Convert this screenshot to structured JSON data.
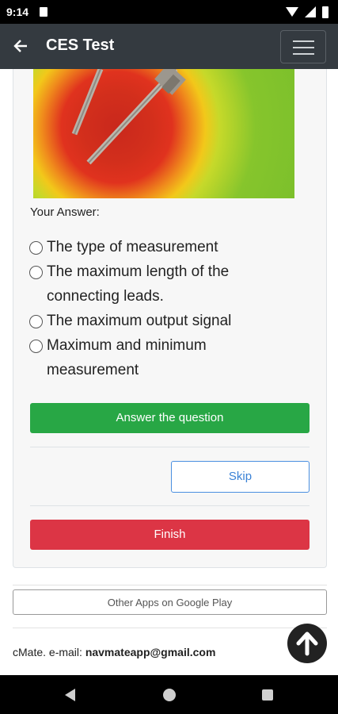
{
  "status_bar": {
    "time": "9:14"
  },
  "app_bar": {
    "title": "CES Test"
  },
  "question": {
    "answer_label": "Your Answer:",
    "options": [
      "The type of measurement",
      "The maximum length of the connecting leads.",
      "The maximum output signal",
      "Maximum and minimum measurement"
    ]
  },
  "buttons": {
    "answer": "Answer the question",
    "skip": "Skip",
    "finish": "Finish",
    "other_apps": "Other Apps on Google Play"
  },
  "footer": {
    "prefix": "cMate. e-mail: ",
    "email": "navmateapp@gmail.com"
  },
  "colors": {
    "app_bar": "#343a40",
    "answer_button": "#28a745",
    "finish_button": "#dc3545",
    "skip_border": "#4a8fe0"
  },
  "icons": [
    "back-arrow-icon",
    "hamburger-menu-icon",
    "arrow-up-icon",
    "wifi-icon",
    "signal-icon",
    "battery-icon"
  ]
}
